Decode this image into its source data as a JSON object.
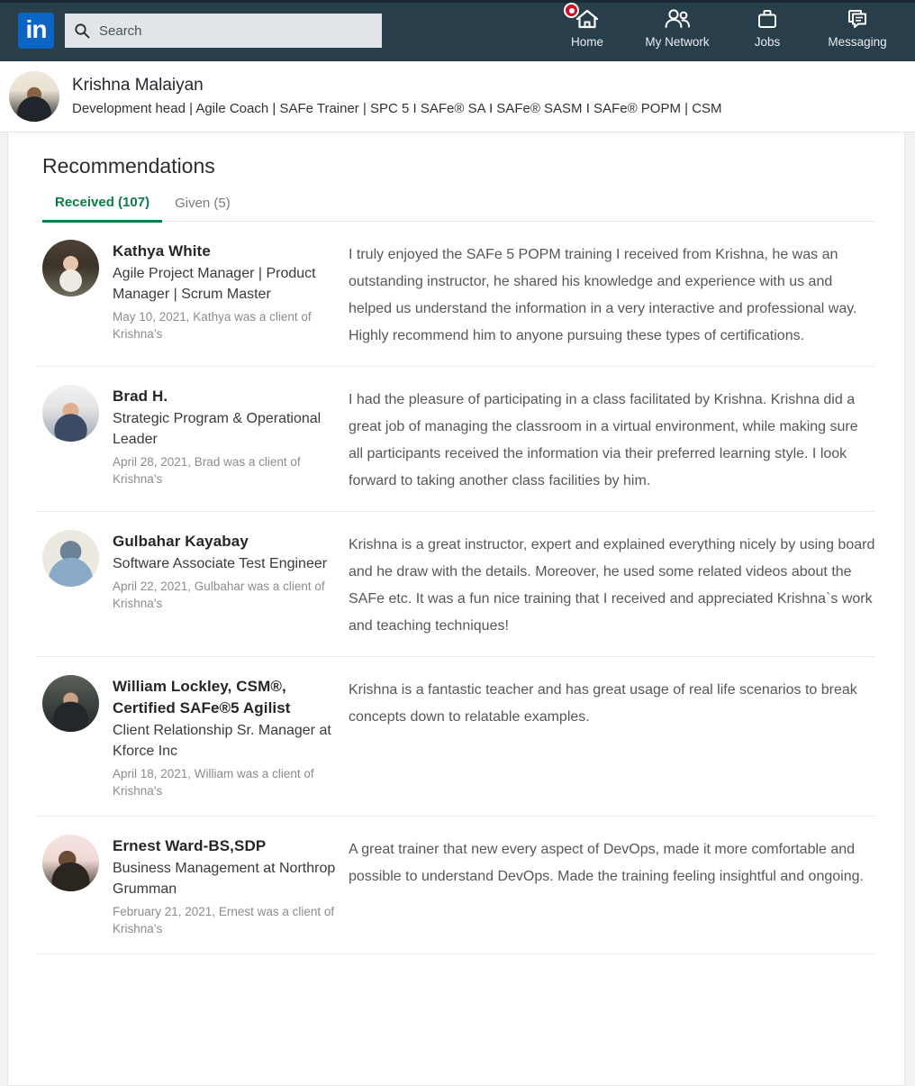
{
  "topnav": {
    "logo_text": "in",
    "logo_name": "linkedin-logo",
    "search": {
      "placeholder": "Search",
      "value": "",
      "icon": "search-icon"
    },
    "items": [
      {
        "label": "Home",
        "icon": "home-icon",
        "badge": true
      },
      {
        "label": "My Network",
        "icon": "people-icon",
        "badge": false
      },
      {
        "label": "Jobs",
        "icon": "briefcase-icon",
        "badge": false
      },
      {
        "label": "Messaging",
        "icon": "message-icon",
        "badge": false
      }
    ]
  },
  "profile": {
    "name": "Krishna Malaiyan",
    "headline": "Development head | Agile Coach | SAFe Trainer | SPC 5 I SAFe® SA I SAFe® SASM I SAFe® POPM | CSM",
    "avatar_name": "profile-avatar"
  },
  "section": {
    "title": "Recommendations",
    "tabs": [
      {
        "label": "Received (107)",
        "active": true
      },
      {
        "label": "Given (5)",
        "active": false
      }
    ]
  },
  "recommendations": [
    {
      "name": "Kathya White",
      "title": "Agile Project Manager | Product Manager | Scrum Master",
      "date": "May 10, 2021, Kathya was a client of Krishna’s",
      "text": "I truly enjoyed the SAFe 5 POPM training I received from Krishna, he was an outstanding instructor, he shared his knowledge and experience with us and helped us understand the information in a very interactive and professional way. Highly recommend him to anyone pursuing these types of certifications."
    },
    {
      "name": "Brad H.",
      "title": "Strategic Program & Operational Leader",
      "date": "April 28, 2021, Brad was a client of Krishna’s",
      "text": "I had the pleasure of participating in a class facilitated by Krishna. Krishna did a great job of managing the classroom in a virtual environment, while making sure all participants received the information via their preferred learning style. I look forward to taking another class facilities by him."
    },
    {
      "name": "Gulbahar Kayabay",
      "title": "Software Associate Test Engineer",
      "date": "April 22, 2021, Gulbahar was a client of Krishna’s",
      "text": "Krishna is a great instructor, expert and explained everything nicely by using board and he draw with the details. Moreover, he used some related videos about the SAFe etc. It was a fun nice training that I received and appreciated Krishna`s work and teaching techniques!"
    },
    {
      "name": "William Lockley, CSM®, Certified SAFe®5 Agilist",
      "title": "Client Relationship Sr. Manager at Kforce Inc",
      "date": "April 18, 2021, William was a client of Krishna’s",
      "text": "Krishna is a fantastic teacher and has great usage of real life scenarios to break concepts down to relatable examples."
    },
    {
      "name": "Ernest Ward-BS,SDP",
      "title": "Business Management at Northrop Grumman",
      "date": "February 21, 2021, Ernest was a client of Krishna’s",
      "text": "A great trainer that new every aspect of DevOps, made it more comfortable and possible to understand DevOps. Made the training feeling insightful and ongoing."
    }
  ],
  "colors": {
    "nav_background": "#283e4a",
    "logo_blue": "#0a66c2",
    "tab_active_green": "#0a7d49",
    "badge_red": "#d11124",
    "page_background": "#f3f2f0"
  }
}
